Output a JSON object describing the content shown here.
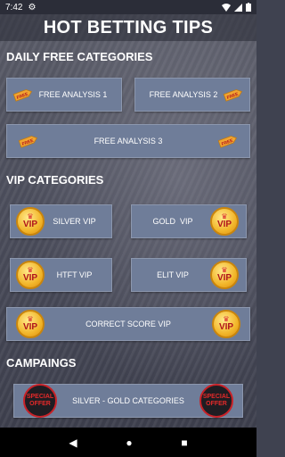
{
  "status": {
    "time": "7:42"
  },
  "app": {
    "title": "HOT BETTING TIPS"
  },
  "daily": {
    "title": "DAILY FREE CATEGORIES",
    "items": [
      {
        "label": "FREE ANALYSIS 1"
      },
      {
        "label": "FREE ANALYSIS 2"
      },
      {
        "label": "FREE ANALYSIS 3"
      }
    ]
  },
  "vip": {
    "title": "VIP CATEGORIES",
    "items": [
      {
        "label": "SILVER VIP"
      },
      {
        "label": "GOLD  VIP"
      },
      {
        "label": "HTFT VIP"
      },
      {
        "label": "ELIT VIP"
      },
      {
        "label": "CORRECT SCORE VIP"
      }
    ],
    "badge_text": "VIP"
  },
  "campaigns": {
    "title": "CAMPAINGS",
    "items": [
      {
        "label": "SILVER - GOLD CATEGORIES"
      }
    ],
    "offer_line1": "SPECIAL",
    "offer_line2": "OFFER"
  },
  "free_tag_text": "FREE",
  "colors": {
    "card": "#6f7d99",
    "tag": "#f0a531",
    "medal": "#f2b62a",
    "offer_ring": "#c82127"
  }
}
